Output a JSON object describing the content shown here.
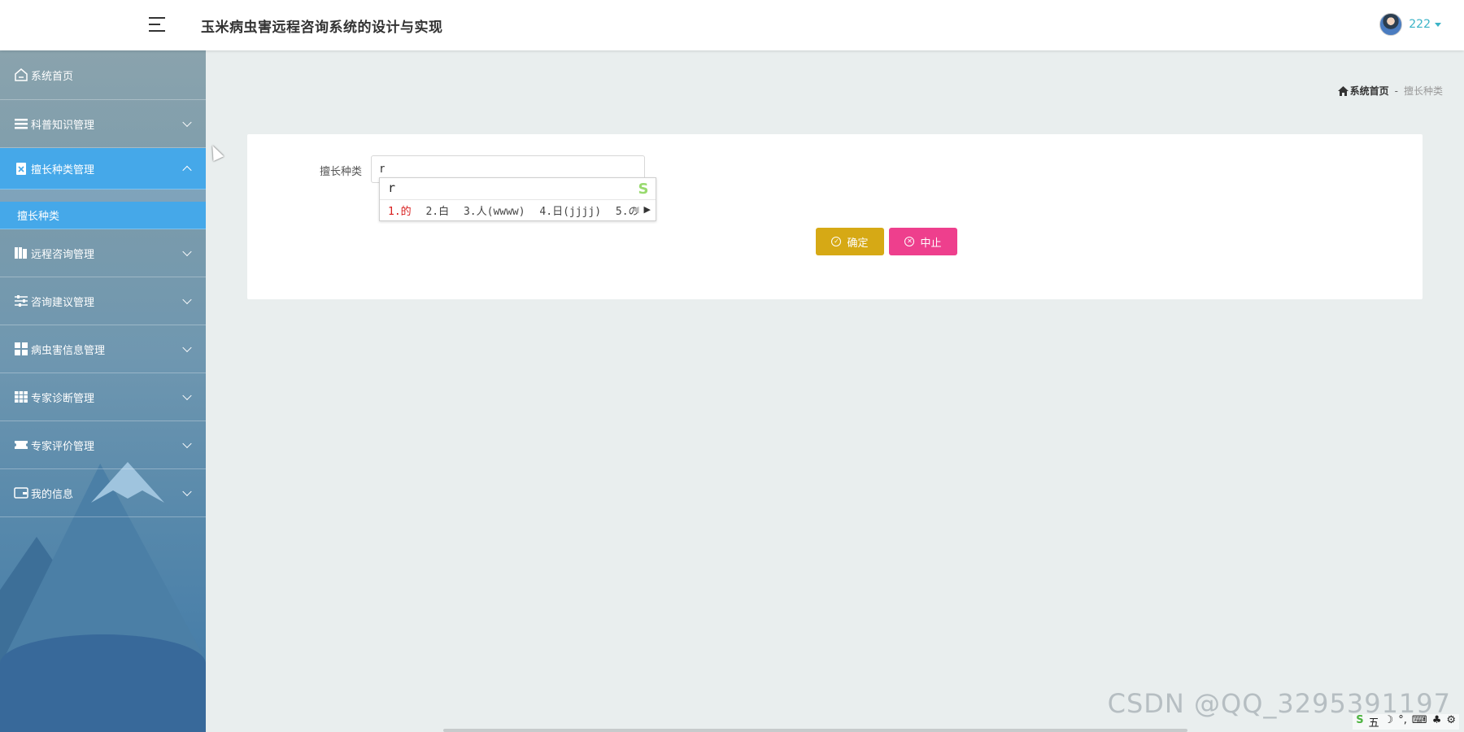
{
  "header": {
    "app_title": "玉米病虫害远程咨询系统的设计与实现",
    "username": "222"
  },
  "sidebar": {
    "items": [
      {
        "label": "系统首页",
        "icon": "home-icon"
      },
      {
        "label": "科普知识管理",
        "icon": "list-icon"
      },
      {
        "label": "擅长种类管理",
        "icon": "clipboard-icon",
        "open": true,
        "children": [
          {
            "label": "擅长种类"
          }
        ]
      },
      {
        "label": "远程咨询管理",
        "icon": "book-icon"
      },
      {
        "label": "咨询建议管理",
        "icon": "sliders-icon"
      },
      {
        "label": "病虫害信息管理",
        "icon": "grid-icon"
      },
      {
        "label": "专家诊断管理",
        "icon": "table-icon"
      },
      {
        "label": "专家评价管理",
        "icon": "ticket-icon"
      },
      {
        "label": "我的信息",
        "icon": "wallet-icon"
      }
    ]
  },
  "breadcrumb": {
    "home": "系统首页",
    "separator": "-",
    "current": "擅长种类"
  },
  "form": {
    "field_label": "擅长种类",
    "field_value": "r",
    "confirm_label": "确定",
    "cancel_label": "中止"
  },
  "ime": {
    "composition": "r",
    "candidates": [
      "1.的",
      "2.白",
      "3.人(wwww)",
      "4.日(jjjj)",
      "5.の"
    ]
  },
  "tray": {
    "items": [
      "五",
      "☽",
      "°,",
      "⌨",
      "♣",
      "⚙"
    ]
  },
  "watermark": "CSDN @QQ_3295391197",
  "colors": {
    "accent": "#45a8e9",
    "confirm": "#d6a915",
    "cancel": "#ee3f8d",
    "username": "#3ab3c6"
  }
}
